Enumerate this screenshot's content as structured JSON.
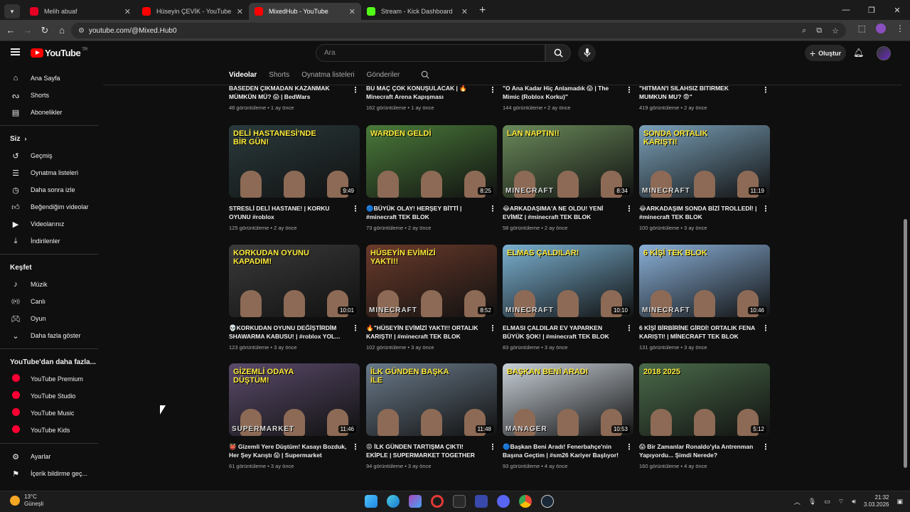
{
  "browser": {
    "tabs": [
      {
        "title": "Melih abuaf",
        "color": "#e60023",
        "active": false
      },
      {
        "title": "Hüseyin ÇEVİK - YouTube",
        "color": "#ff0000",
        "active": false
      },
      {
        "title": "MixedHub - YouTube",
        "color": "#ff0000",
        "active": true
      },
      {
        "title": "Stream - Kick Dashboard",
        "color": "#53fc18",
        "active": false
      }
    ],
    "url": "youtube.com/@Mixed.Hub0"
  },
  "header": {
    "logo": "YouTube",
    "region": "TR",
    "search_placeholder": "Ara",
    "create_label": "Oluştur"
  },
  "sidebar": {
    "main": [
      {
        "label": "Ana Sayfa",
        "icon": "home-icon"
      },
      {
        "label": "Shorts",
        "icon": "shorts-icon"
      },
      {
        "label": "Abonelikler",
        "icon": "subscriptions-icon"
      }
    ],
    "you_heading": "Siz",
    "you": [
      {
        "label": "Geçmiş",
        "icon": "history-icon"
      },
      {
        "label": "Oynatma listeleri",
        "icon": "playlists-icon"
      },
      {
        "label": "Daha sonra izle",
        "icon": "watch-later-icon"
      },
      {
        "label": "Beğendiğim videolar",
        "icon": "like-icon"
      },
      {
        "label": "Videolarınız",
        "icon": "your-videos-icon"
      },
      {
        "label": "İndirilenler",
        "icon": "download-icon"
      }
    ],
    "explore_heading": "Keşfet",
    "explore": [
      {
        "label": "Müzik",
        "icon": "music-icon"
      },
      {
        "label": "Canlı",
        "icon": "live-icon"
      },
      {
        "label": "Oyun",
        "icon": "gaming-icon"
      },
      {
        "label": "Daha fazla göster",
        "icon": "chevron-down-icon"
      }
    ],
    "more_heading": "YouTube'dan daha fazla...",
    "more": [
      {
        "label": "YouTube Premium"
      },
      {
        "label": "YouTube Studio"
      },
      {
        "label": "YouTube Music"
      },
      {
        "label": "YouTube Kids"
      }
    ],
    "bottom": [
      {
        "label": "Ayarlar",
        "icon": "settings-icon"
      },
      {
        "label": "İçerik bildirme geç...",
        "icon": "flag-icon"
      }
    ]
  },
  "channel_tabs": [
    "Videolar",
    "Shorts",
    "Oynatma listeleri",
    "Gönderiler"
  ],
  "active_tab": "Videolar",
  "top_row": [
    {
      "title": "BASEDEN ÇIKMADAN KAZANMAK MÜMKÜN MÜ? 😱 | BedWars",
      "meta": "48 görüntüleme • 1 ay önce"
    },
    {
      "title": "BU MAÇ ÇOK KONUŞULACAK | 🔥 Minecraft Arena Kapışması",
      "meta": "162 görüntüleme • 1 ay önce"
    },
    {
      "title": "\"O Ana Kadar Hiç Anlamadık 😱 | The Mimic (Roblox Korku)\"",
      "meta": "144 görüntüleme • 2 ay önce"
    },
    {
      "title": "\"HITMAN'I SILAHSIZ BITIRMEK MUMKUN MU? 😨\"",
      "meta": "419 görüntüleme • 2 ay önce"
    }
  ],
  "videos": [
    {
      "title": "STRESLİ DELİ HASTANE! | KORKU OYUNU #roblox",
      "meta": "125 görüntüleme • 2 ay önce",
      "duration": "9:49",
      "overlay": "DELİ HASTANESİ'NDE BİR GÜN!",
      "bg": "#2a3a3c",
      "mc": ""
    },
    {
      "title": "🔵BÜYÜK OLAY! HERŞEY BİTTİ | #minecraft TEK BLOK",
      "meta": "73 görüntüleme • 2 ay önce",
      "duration": "8:25",
      "overlay": "WARDEN GELDİ",
      "bg": "#4a7a3a",
      "mc": ""
    },
    {
      "title": "😂ARKADAŞIMA'A NE OLDU! YENİ EVİMİZ | #minecraft TEK BLOK",
      "meta": "58 görüntüleme • 2 ay önce",
      "duration": "8:34",
      "overlay": "LAN NAPTIN!!",
      "bg": "#6a8a5a",
      "mc": "MINECRAFT"
    },
    {
      "title": "😂ARKADAŞIM SONDA BİZİ TROLLEDİ! | #minecraft TEK BLOK",
      "meta": "100 görüntüleme • 3 ay önce",
      "duration": "11:19",
      "overlay": "SONDA ORTALIK KARIŞTI!",
      "bg": "#7aa0b8",
      "mc": "MINECRAFT"
    },
    {
      "title": "💀KORKUDAN OYUNU DEĞİŞTİRDİM SHAWARMA KABUSU! | #roblox YOL...",
      "meta": "123 görüntüleme • 3 ay önce",
      "duration": "10:01",
      "overlay": "KORKUDAN OYUNU KAPADIM!",
      "bg": "#3a3a3a",
      "mc": ""
    },
    {
      "title": "🔥\"HÜSEYİN EVİMİZİ YAKTI!! ORTALIK KARIŞTI! | #minecraft TEK BLOK",
      "meta": "102 görüntüleme • 3 ay önce",
      "duration": "8:52",
      "overlay": "HÜSEYİN EVİMİZİ YAKTI!!",
      "bg": "#6a3a2a",
      "mc": "MINECRAFT"
    },
    {
      "title": "ELMASI ÇALDILAR EV YAPARKEN BÜYÜK ŞOK! | #minecraft TEK BLOK",
      "meta": "83 görüntüleme • 3 ay önce",
      "duration": "10:10",
      "overlay": "ELMAS ÇALDILAR!",
      "bg": "#7ab0d0",
      "mc": "MINECRAFT"
    },
    {
      "title": "6 KİŞİ BİRBİRİNE GİRDİ! ORTALIK FENA KARIŞTI! | MİNECRAFT TEK BLOK",
      "meta": "131 görüntüleme • 3 ay önce",
      "duration": "10:46",
      "overlay": "6 KİŞİ TEK BLOK",
      "bg": "#8ab0d8",
      "mc": "MINECRAFT"
    },
    {
      "title": "👹 Gizemli Yere Düştüm! Kasayı Bozduk, Her Şey Karıştı 😱 | Supermarket Together",
      "meta": "61 görüntüleme • 3 ay önce",
      "duration": "11:46",
      "overlay": "GİZEMLİ ODAYA DÜŞTÜM!",
      "bg": "#5a4a6a",
      "mc": "SUPERMARKET"
    },
    {
      "title": "😡 İLK GÜNDEN TARTIŞMA ÇIKTI! EKİPLE | SUPERMARKET TOGETHER",
      "meta": "94 görüntüleme • 3 ay önce",
      "duration": "11:48",
      "overlay": "İLK GÜNDEN BAŞKA İLE",
      "bg": "#6a7a8a",
      "mc": ""
    },
    {
      "title": "🔵Başkan Beni Aradı! Fenerbahçe'nin Başına Geçtim | #sm26 Kariyer Başlıyor!",
      "meta": "93 görüntüleme • 4 ay önce",
      "duration": "10:53",
      "overlay": "BAŞKAN BENİ ARADI",
      "bg": "#c8d0d8",
      "mc": "MANAGER"
    },
    {
      "title": "😱 Bir Zamanlar Ronaldo'yla Antrenman Yapıyordu... Şimdi Nerede?",
      "meta": "160 görüntüleme • 4 ay önce",
      "duration": "5:12",
      "overlay": "2018   2025",
      "bg": "#4a6a4a",
      "mc": ""
    }
  ],
  "taskbar": {
    "temp": "13°C",
    "weather": "Güneşli",
    "time": "21:32",
    "date": "3.03.2026"
  }
}
